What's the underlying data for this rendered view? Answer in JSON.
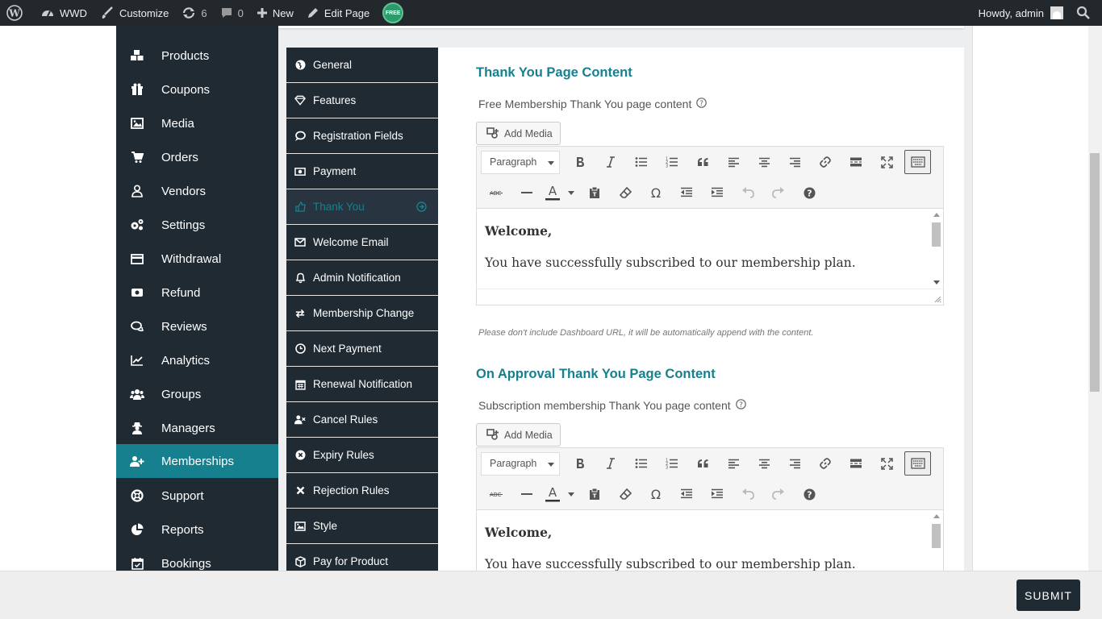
{
  "adminbar": {
    "site_name": "WWD",
    "customize": "Customize",
    "updates_count": "6",
    "comments_count": "0",
    "new_label": "New",
    "edit_page": "Edit Page",
    "plugin_badge": "FREE",
    "howdy": "Howdy, admin"
  },
  "sidebar": {
    "items": [
      {
        "label": "Products",
        "icon": "cubes-icon"
      },
      {
        "label": "Coupons",
        "icon": "gift-icon"
      },
      {
        "label": "Media",
        "icon": "image-icon"
      },
      {
        "label": "Orders",
        "icon": "cart-icon"
      },
      {
        "label": "Vendors",
        "icon": "user-icon"
      },
      {
        "label": "Settings",
        "icon": "cogs-icon"
      },
      {
        "label": "Withdrawal",
        "icon": "credit-card-icon"
      },
      {
        "label": "Refund",
        "icon": "exchange-icon"
      },
      {
        "label": "Reviews",
        "icon": "comments-icon"
      },
      {
        "label": "Analytics",
        "icon": "line-chart-icon"
      },
      {
        "label": "Groups",
        "icon": "users-icon"
      },
      {
        "label": "Managers",
        "icon": "user-secret-icon"
      },
      {
        "label": "Memberships",
        "icon": "user-plus-icon"
      },
      {
        "label": "Support",
        "icon": "life-ring-icon"
      },
      {
        "label": "Reports",
        "icon": "pie-chart-icon"
      },
      {
        "label": "Bookings",
        "icon": "calendar-check-icon"
      }
    ],
    "active_label": "Memberships"
  },
  "tabs": {
    "items": [
      {
        "label": "General",
        "icon": "globe-icon"
      },
      {
        "label": "Features",
        "icon": "diamond-icon"
      },
      {
        "label": "Registration Fields",
        "icon": "comment-icon"
      },
      {
        "label": "Payment",
        "icon": "money-icon"
      },
      {
        "label": "Thank You",
        "icon": "thumbs-up-icon"
      },
      {
        "label": "Welcome Email",
        "icon": "envelope-icon"
      },
      {
        "label": "Admin Notification",
        "icon": "bell-icon"
      },
      {
        "label": "Membership Change",
        "icon": "exchange-icon"
      },
      {
        "label": "Next Payment",
        "icon": "clock-icon"
      },
      {
        "label": "Renewal Notification",
        "icon": "calendar-icon"
      },
      {
        "label": "Cancel Rules",
        "icon": "user-times-icon"
      },
      {
        "label": "Expiry Rules",
        "icon": "times-circle-icon"
      },
      {
        "label": "Rejection Rules",
        "icon": "times-icon"
      },
      {
        "label": "Style",
        "icon": "image-icon"
      },
      {
        "label": "Pay for Product",
        "icon": "cube-icon"
      }
    ],
    "active_label": "Thank You"
  },
  "panel": {
    "section1": {
      "title": "Thank You Page Content",
      "field_label": "Free Membership Thank You page content",
      "add_media": "Add Media",
      "format": "Paragraph",
      "content_heading": "Welcome,",
      "content_text": "You have successfully subscribed to our membership plan.",
      "note": "Please don't include Dashboard URL, it will be automatically append with the content."
    },
    "section2": {
      "title": "On Approval Thank You Page Content",
      "field_label": "Subscription membership Thank You page content",
      "add_media": "Add Media",
      "format": "Paragraph",
      "content_heading": "Welcome,",
      "content_text": "You have successfully subscribed to our membership plan."
    }
  },
  "footer": {
    "submit": "SUBMIT"
  },
  "colors": {
    "accent": "#17808f",
    "sidebar_bg": "#1f2a33",
    "adminbar_bg": "#23282d"
  }
}
